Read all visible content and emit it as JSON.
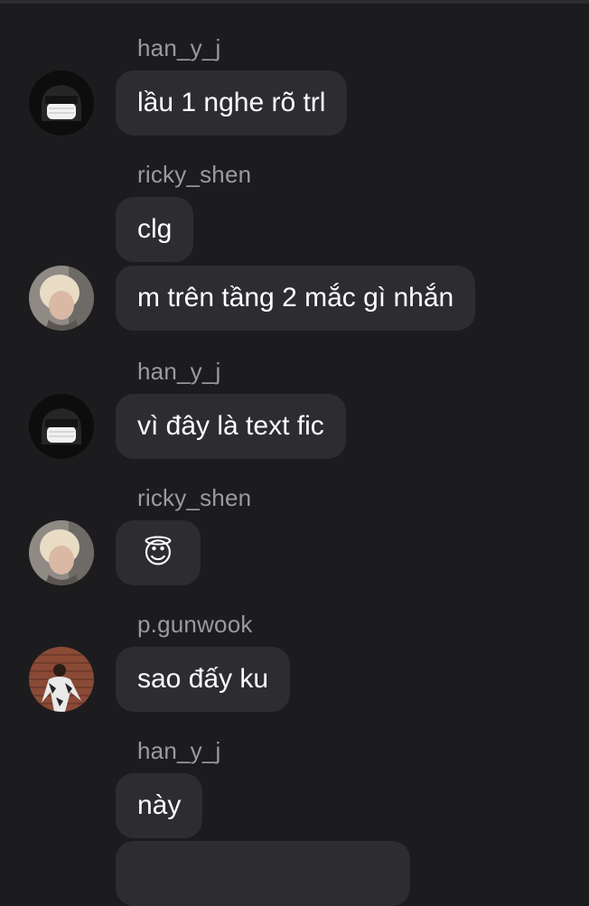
{
  "messages": [
    {
      "sender": "han_y_j",
      "text": "lầu 1 nghe rõ trl",
      "avatar": "masked-user-avatar"
    },
    {
      "sender": "ricky_shen",
      "text": "clg"
    },
    {
      "text": "m trên tầng 2 mắc gì nhắn",
      "avatar": "blonde-user-avatar"
    },
    {
      "sender": "han_y_j",
      "text": "vì đây là text fic",
      "avatar": "masked-user-avatar"
    },
    {
      "sender": "ricky_shen",
      "text": "😇",
      "avatar": "blonde-user-avatar",
      "emoji_name": "smiling-face-with-halo"
    },
    {
      "sender": "p.gunwook",
      "text": "sao đấy ku",
      "avatar": "brick-wall-user-avatar"
    },
    {
      "sender": "han_y_j",
      "text": "này"
    }
  ],
  "colors": {
    "background": "#1c1c1e",
    "bubble": "#2d2d31",
    "sender_name": "#9a9aa0",
    "message_text": "#ffffff"
  }
}
